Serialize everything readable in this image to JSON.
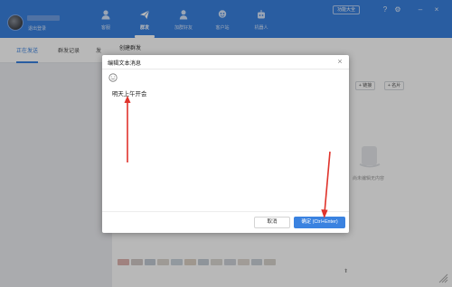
{
  "header": {
    "profile_subtitle": "退出登录",
    "nav": [
      {
        "label": "客服",
        "icon": "chat-icon"
      },
      {
        "label": "群发",
        "icon": "send-icon"
      },
      {
        "label": "加群好友",
        "icon": "add-friend-icon"
      },
      {
        "label": "客户站",
        "icon": "customer-icon"
      },
      {
        "label": "机器人",
        "icon": "robot-icon"
      }
    ],
    "feature_button": "功能大全",
    "window_icons": [
      "help-icon",
      "settings-icon",
      "minimize-icon",
      "close-icon"
    ],
    "accent_color": "#3a82e0"
  },
  "left": {
    "tabs": [
      "正在发送",
      "群发记录",
      "发"
    ]
  },
  "main": {
    "title": "创建群发",
    "link_button": "+ 链接",
    "card_button": "+ 名片",
    "empty_text": "尚未编辑无内容"
  },
  "dialog": {
    "title": "编辑文本消息",
    "close_symbol": "×",
    "message_text": "明天上午开会",
    "cancel_label": "取消",
    "ok_label": "确定 (Ctrl+Enter)",
    "ok_color": "#3a82e0"
  },
  "annotations": {
    "arrow_color": "#e0342c"
  }
}
